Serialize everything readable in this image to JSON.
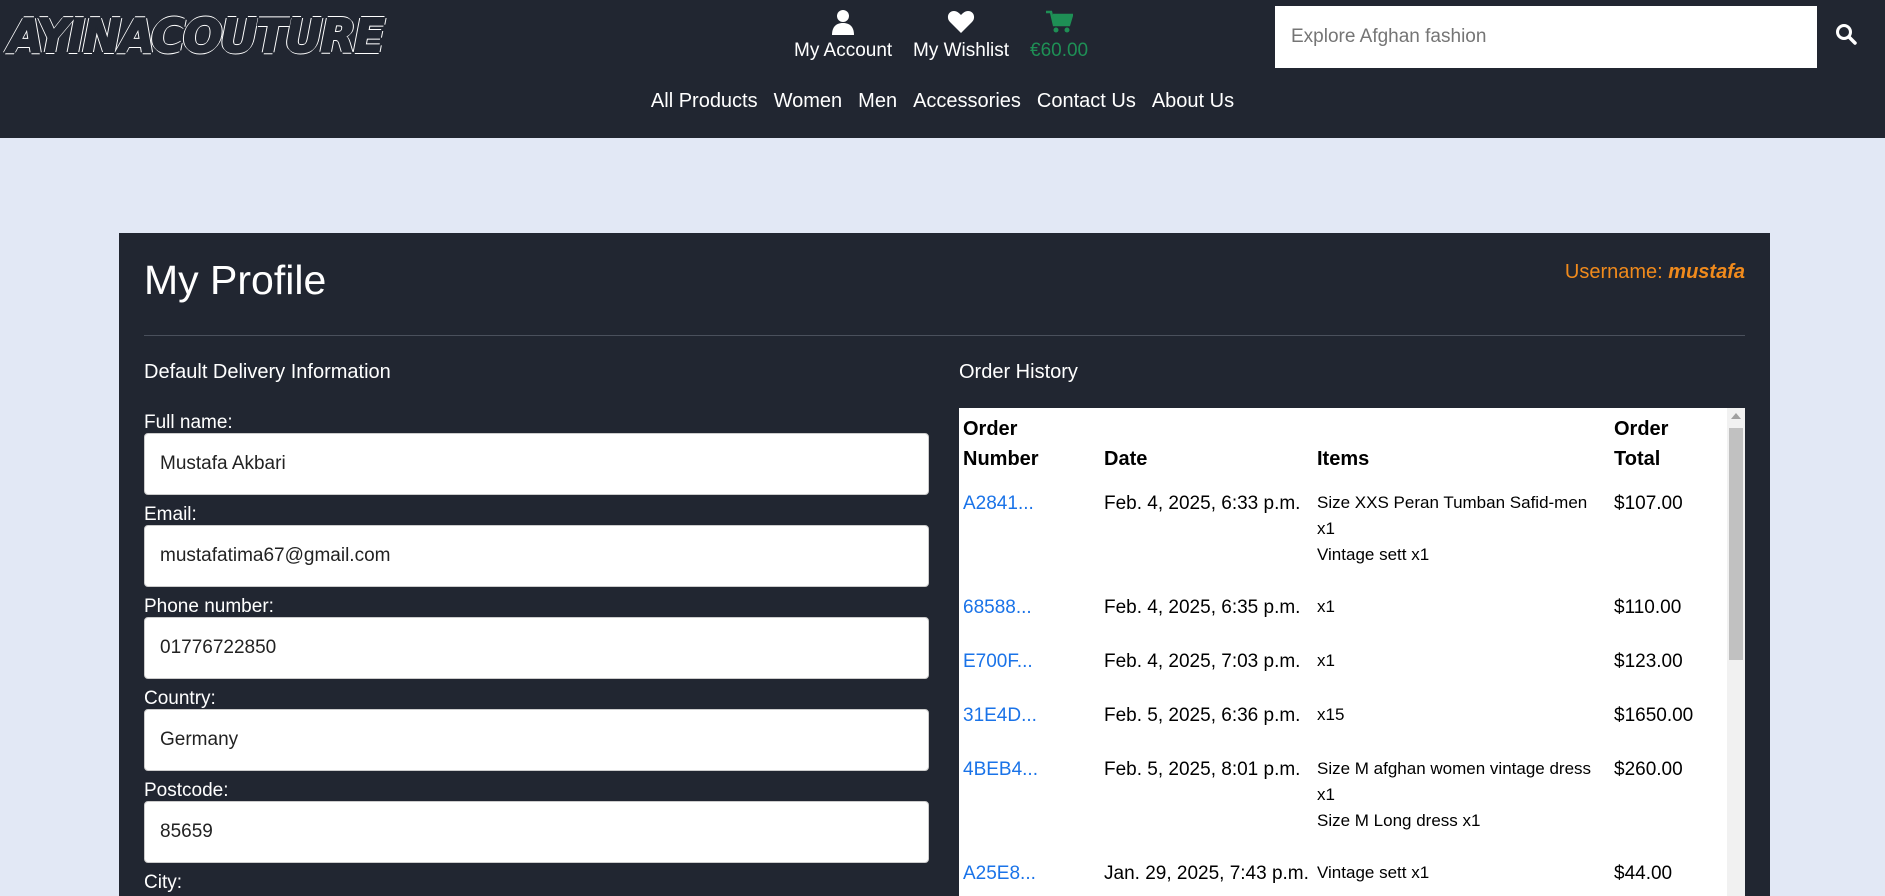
{
  "header": {
    "logo": "AYINACOUTURE",
    "nav_icons": [
      {
        "label": "My Account",
        "icon": "user-icon"
      },
      {
        "label": "My Wishlist",
        "icon": "heart-icon"
      },
      {
        "label": "€60.00",
        "icon": "cart-icon"
      }
    ],
    "search": {
      "placeholder": "Explore Afghan fashion",
      "icon": "search-icon"
    },
    "menu": [
      "All Products",
      "Women",
      "Men",
      "Accessories",
      "Contact Us",
      "About Us"
    ]
  },
  "profile": {
    "title": "My Profile",
    "username_label": "Username:",
    "username": "mustafa",
    "delivery_title": "Default Delivery Information",
    "fields": [
      {
        "label": "Full name:",
        "value": "Mustafa Akbari"
      },
      {
        "label": "Email:",
        "value": "mustafatima67@gmail.com"
      },
      {
        "label": "Phone number:",
        "value": "01776722850"
      },
      {
        "label": "Country:",
        "value": "Germany"
      },
      {
        "label": "Postcode:",
        "value": "85659"
      },
      {
        "label": "City:",
        "value": ""
      }
    ]
  },
  "orders": {
    "title": "Order History",
    "columns": [
      "Order Number",
      "Date",
      "Items",
      "Order Total"
    ],
    "rows": [
      {
        "number": "A2841...",
        "date": "Feb. 4, 2025, 6:33 p.m.",
        "items": [
          "Size XXS Peran Tumban Safid-men x1",
          "Vintage sett x1"
        ],
        "total": "$107.00"
      },
      {
        "number": "68588...",
        "date": "Feb. 4, 2025, 6:35 p.m.",
        "items": [
          "x1"
        ],
        "total": "$110.00"
      },
      {
        "number": "E700F...",
        "date": "Feb. 4, 2025, 7:03 p.m.",
        "items": [
          "x1"
        ],
        "total": "$123.00"
      },
      {
        "number": "31E4D...",
        "date": "Feb. 5, 2025, 6:36 p.m.",
        "items": [
          "x15"
        ],
        "total": "$1650.00"
      },
      {
        "number": "4BEB4...",
        "date": "Feb. 5, 2025, 8:01 p.m.",
        "items": [
          "Size M afghan women vintage dress x1",
          "Size M Long dress x1"
        ],
        "total": "$260.00"
      },
      {
        "number": "A25E8...",
        "date": "Jan. 29, 2025, 7:43 p.m.",
        "items": [
          "Vintage sett x1"
        ],
        "total": "$44.00"
      }
    ]
  },
  "colors": {
    "header_bg": "#212631",
    "page_bg": "#e2e8f5",
    "accent_orange": "#f08a1c",
    "cart_green": "#1e8f55",
    "link_blue": "#1a73e8"
  }
}
